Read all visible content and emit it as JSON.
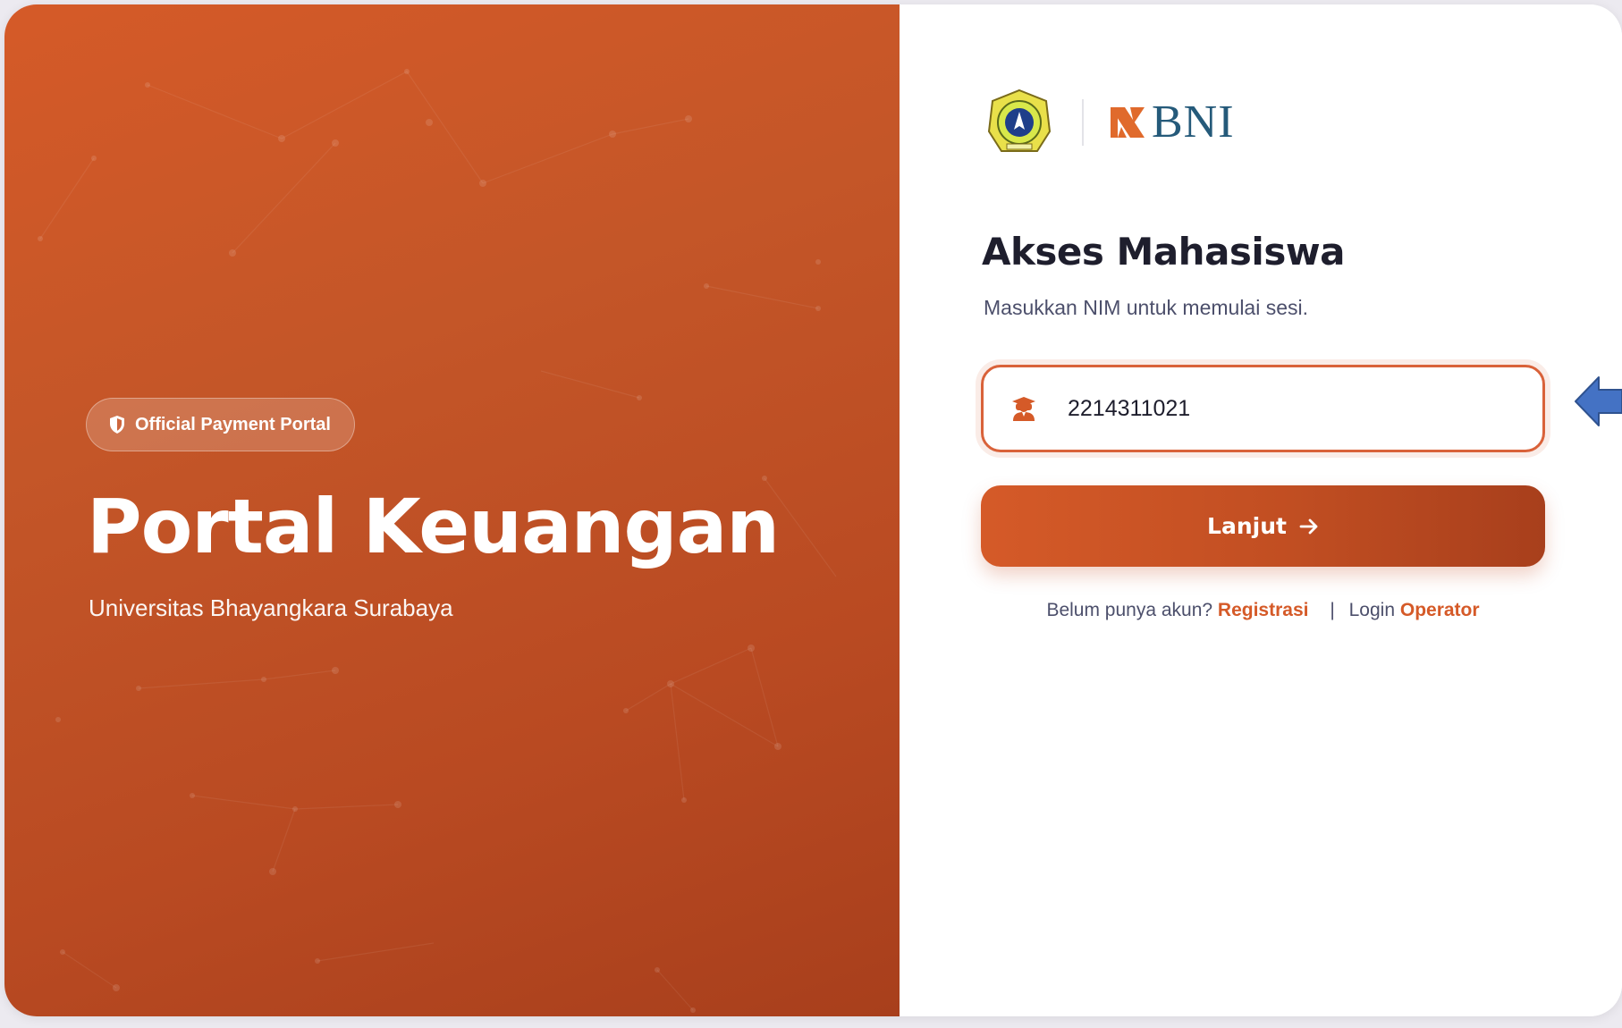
{
  "hero": {
    "badge_label": "Official Payment Portal",
    "title": "Portal Keuangan",
    "subtitle": "Universitas Bhayangkara Surabaya"
  },
  "logos": {
    "partner_name": "BNI"
  },
  "form": {
    "title": "Akses Mahasiswa",
    "subtitle": "Masukkan NIM untuk memulai sesi.",
    "nim_value": "2214311021",
    "submit_label": "Lanjut"
  },
  "footer": {
    "no_account_text": "Belum punya akun?",
    "register_link": "Registrasi",
    "divider": "|",
    "login_text": "Login",
    "operator_link": "Operator"
  },
  "colors": {
    "brand_orange": "#d55a28",
    "dark_orange": "#a83f1c",
    "text_dark": "#1e1e2d",
    "text_muted": "#4c4f6b",
    "bni_blue": "#255a7a"
  },
  "icons": {
    "badge": "shield-icon",
    "input": "student-icon",
    "button": "arrow-right-icon",
    "annotation": "arrow-left-icon"
  }
}
